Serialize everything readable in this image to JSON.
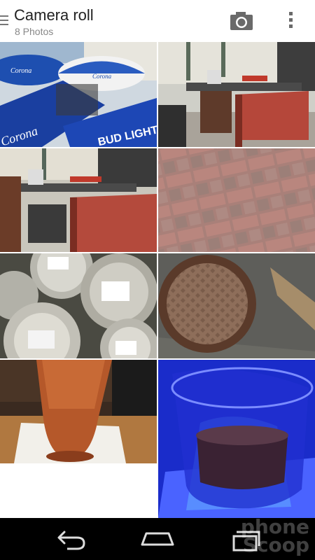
{
  "header": {
    "title": "Camera roll",
    "subtitle": "8 Photos",
    "camera_icon": "camera-icon",
    "overflow_icon": "overflow-menu-icon",
    "drawer_icon": "menu-icon"
  },
  "photos": [
    {
      "name": "photo-umbrellas",
      "subject": "umbrellas"
    },
    {
      "name": "photo-patio-table-1",
      "subject": "patio"
    },
    {
      "name": "photo-patio-table-2",
      "subject": "patio"
    },
    {
      "name": "photo-brick-pavers",
      "subject": "bricks"
    },
    {
      "name": "photo-kegs",
      "subject": "kegs"
    },
    {
      "name": "photo-manhole-cover",
      "subject": "manhole"
    },
    {
      "name": "photo-beer-glass",
      "subject": "beer"
    },
    {
      "name": "photo-blue-glass",
      "subject": "blue glass"
    }
  ],
  "navbar": {
    "back_icon": "back-icon",
    "home_icon": "home-icon",
    "recents_icon": "recents-icon"
  },
  "watermark": {
    "line1": "phone",
    "line2": "Scoop"
  },
  "umbrella_text": {
    "brand1": "Corona",
    "brand2": "Corona",
    "brand3": "Corona",
    "brand4": "BUD LIGHT"
  },
  "colors": {
    "umbrella_blue": "#1a3fa0",
    "brick": "#b07a70",
    "glass_blue": "#1f3cff"
  }
}
